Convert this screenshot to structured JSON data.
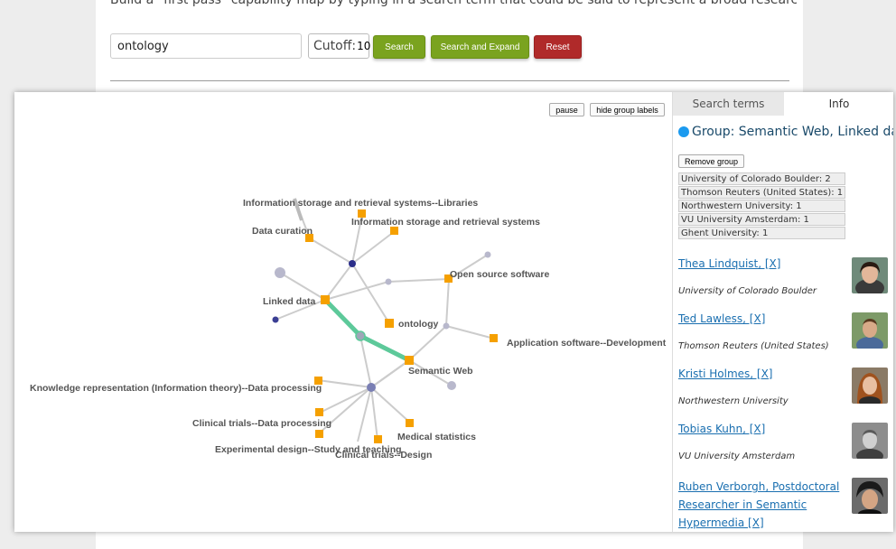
{
  "intro_text": "Build a \"first pass\" capability map by typing in a search term that could be said to represent a broad research capability.",
  "search": {
    "value": "ontology"
  },
  "cutoff": {
    "label": "Cutoff:",
    "value": "10"
  },
  "buttons": {
    "search": "Search",
    "search_expand": "Search and Expand",
    "reset": "Reset"
  },
  "graph": {
    "pause": "pause",
    "hide_labels": "hide group labels",
    "labels": {
      "libraries": "Information storage and retrieval systems--Libraries",
      "isr": "Information storage and retrieval systems",
      "curation": "Data curation",
      "oss": "Open source software",
      "linked": "Linked data",
      "ontology": "ontology",
      "appsw": "Application software--Development",
      "semweb": "Semantic Web",
      "knowrep": "Knowledge representation (Information theory)--Data processing",
      "clinicaldp": "Clinical trials--Data processing",
      "medstat": "Medical statistics",
      "expdesign": "Experimental design--Study and teaching",
      "clinicaldes": "Clinical trials--Design"
    }
  },
  "sidebar": {
    "tabs": {
      "search_terms": "Search terms",
      "info": "Info"
    },
    "group_title": "Group: Semantic Web, Linked data",
    "remove_group": "Remove group",
    "institutions": [
      "University of Colorado Boulder: 2",
      "Thomson Reuters (United States): 1",
      "Northwestern University: 1",
      "VU University Amsterdam: 1",
      "Ghent University: 1"
    ],
    "people": [
      {
        "name": "Thea Lindquist, [X]",
        "affiliation": "University of Colorado Boulder"
      },
      {
        "name": "Ted Lawless, [X]",
        "affiliation": "Thomson Reuters (United States)"
      },
      {
        "name": "Kristi Holmes, [X]",
        "affiliation": "Northwestern University"
      },
      {
        "name": "Tobias Kuhn, [X]",
        "affiliation": "VU University Amsterdam"
      },
      {
        "name": "Ruben Verborgh, Postdoctoral Researcher in Semantic Hypermedia [X]",
        "affiliation": ""
      }
    ]
  },
  "colors": {
    "accent_green": "#7aa31f",
    "reset_red": "#b02a2a",
    "node_orange": "#f5a000",
    "group_dot": "#1b9aef",
    "link_teal": "#5dc99a",
    "link_gray": "#cccccc"
  }
}
